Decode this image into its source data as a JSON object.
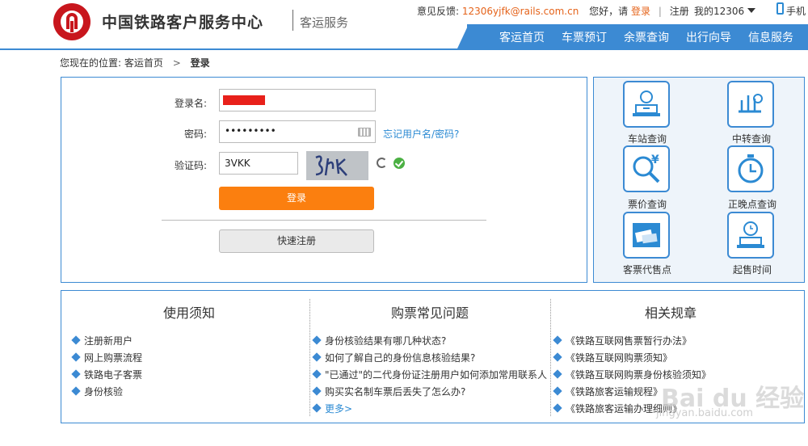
{
  "header": {
    "title": "中国铁路客户服务中心",
    "subtitle": "客运服务",
    "feedback_label": "意见反馈:",
    "feedback_email": "12306yjfk@rails.com.cn",
    "greeting": "您好，请",
    "login_link": "登录",
    "register_link": "注册",
    "my_account": "我的12306",
    "mobile": "手机"
  },
  "nav": [
    "客运首页",
    "车票预订",
    "余票查询",
    "出行向导",
    "信息服务"
  ],
  "breadcrumb": {
    "prefix": "您现在的位置:",
    "home": "客运首页",
    "arrow": ">",
    "current": "登录"
  },
  "login": {
    "username_label": "登录名:",
    "password_label": "密码:",
    "password_value": "•••••••••",
    "captcha_label": "验证码:",
    "captcha_value": "3VKK",
    "forgot_link": "忘记用户名/密码?",
    "login_button": "登录",
    "register_button": "快速注册"
  },
  "quick_links": [
    "车站查询",
    "中转查询",
    "票价查询",
    "正晚点查询",
    "客票代售点",
    "起售时间"
  ],
  "info": {
    "col1": {
      "title": "使用须知",
      "items": [
        "注册新用户",
        "网上购票流程",
        "铁路电子客票",
        "身份核验"
      ]
    },
    "col2": {
      "title": "购票常见问题",
      "items": [
        "身份核验结果有哪几种状态?",
        "如何了解自己的身份信息核验结果?",
        "\"已通过\"的二代身份证注册用户如何添加常用联系人",
        "购买实名制车票后丢失了怎么办?"
      ],
      "more": "更多>"
    },
    "col3": {
      "title": "相关规章",
      "items": [
        "《铁路互联网售票暂行办法》",
        "《铁路互联网购票须知》",
        "《铁路互联网购票身份核验须知》",
        "《铁路旅客运输规程》",
        "《铁路旅客运输办理细则》"
      ]
    }
  },
  "watermark": {
    "brand": "Bai du 经验",
    "url": "jingyan.baidu.com"
  },
  "colors": {
    "accent": "#3c8ad3",
    "login_button": "#fb7f0f",
    "brand_red": "#c8161d",
    "link_orange": "#e5631a"
  }
}
